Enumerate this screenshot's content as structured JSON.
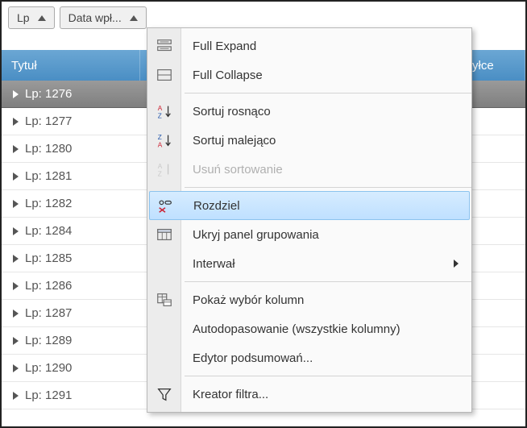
{
  "group_chips": [
    {
      "label": "Lp"
    },
    {
      "label": "Data wpł..."
    }
  ],
  "columns": {
    "title": "Tytuł",
    "right": "yłce"
  },
  "rows": [
    {
      "label": "Lp: 1276",
      "selected": true
    },
    {
      "label": "Lp: 1277"
    },
    {
      "label": "Lp: 1280"
    },
    {
      "label": "Lp: 1281"
    },
    {
      "label": "Lp: 1282"
    },
    {
      "label": "Lp: 1284"
    },
    {
      "label": "Lp: 1285"
    },
    {
      "label": "Lp: 1286"
    },
    {
      "label": "Lp: 1287"
    },
    {
      "label": "Lp: 1289"
    },
    {
      "label": "Lp: 1290"
    },
    {
      "label": "Lp: 1291"
    }
  ],
  "menu": {
    "full_expand": "Full Expand",
    "full_collapse": "Full Collapse",
    "sort_asc": "Sortuj rosnąco",
    "sort_desc": "Sortuj malejąco",
    "clear_sort": "Usuń sortowanie",
    "ungroup": "Rozdziel",
    "hide_group_panel": "Ukryj panel grupowania",
    "interval": "Interwał",
    "column_chooser": "Pokaż wybór kolumn",
    "autofit": "Autodopasowanie (wszystkie kolumny)",
    "summary_editor": "Edytor podsumowań...",
    "filter_wizard": "Kreator filtra..."
  }
}
